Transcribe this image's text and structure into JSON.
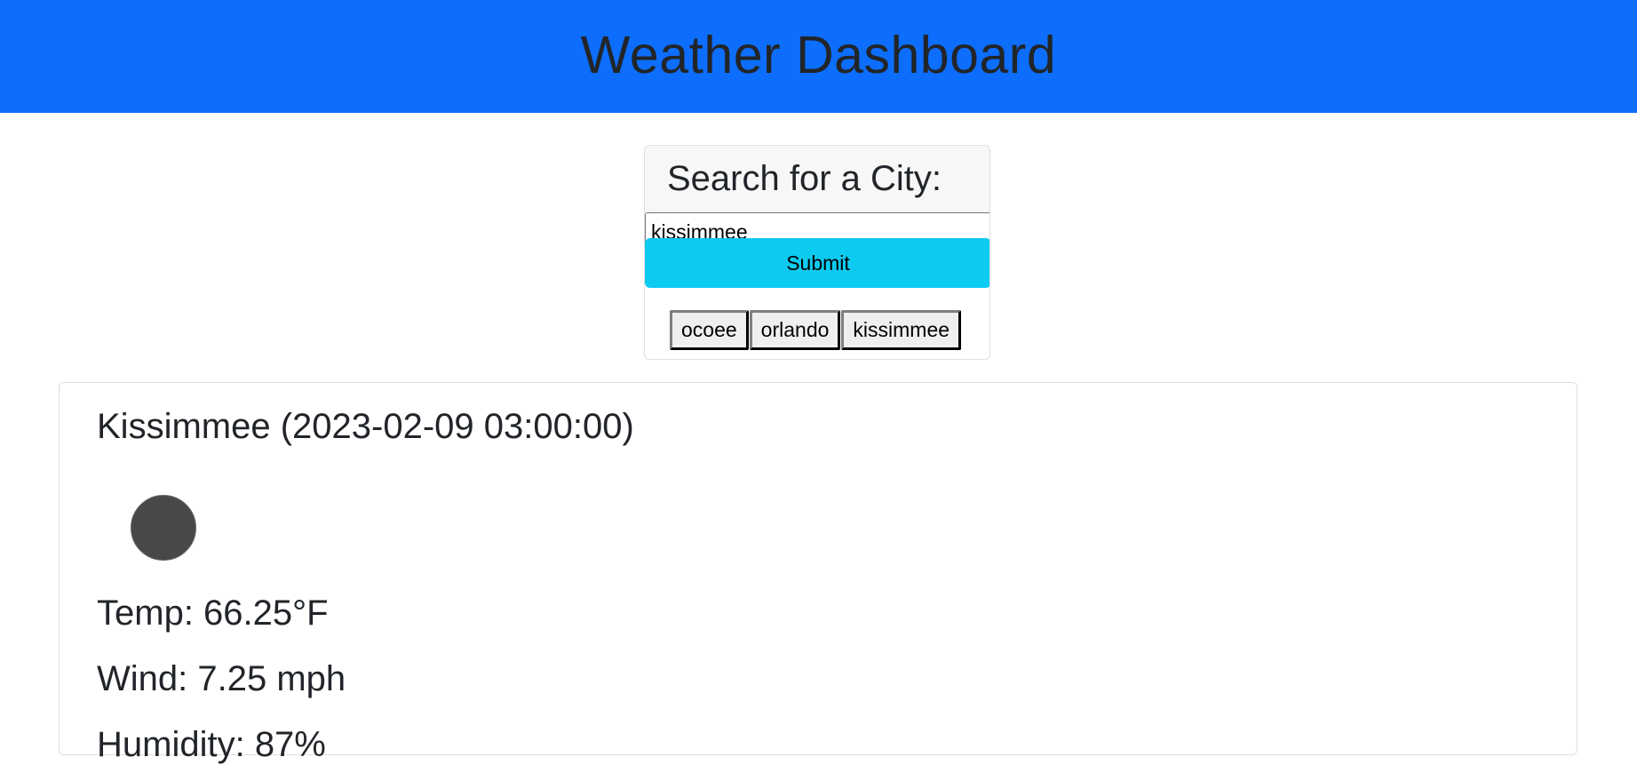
{
  "header": {
    "title": "Weather Dashboard"
  },
  "search": {
    "heading": "Search for a City:",
    "input_value": "kissimmee",
    "submit_label": "Submit",
    "history": [
      "ocoee",
      "orlando",
      "kissimmee"
    ]
  },
  "current": {
    "city_line": "Kissimmee (2023-02-09 03:00:00)",
    "icon": "weather-condition-icon",
    "temp_line": "Temp: 66.25°F",
    "wind_line": "Wind: 7.25 mph",
    "humidity_line": "Humidity: 87%"
  },
  "colors": {
    "header_bg": "#0d6efd",
    "submit_bg": "#0dcaf0"
  }
}
